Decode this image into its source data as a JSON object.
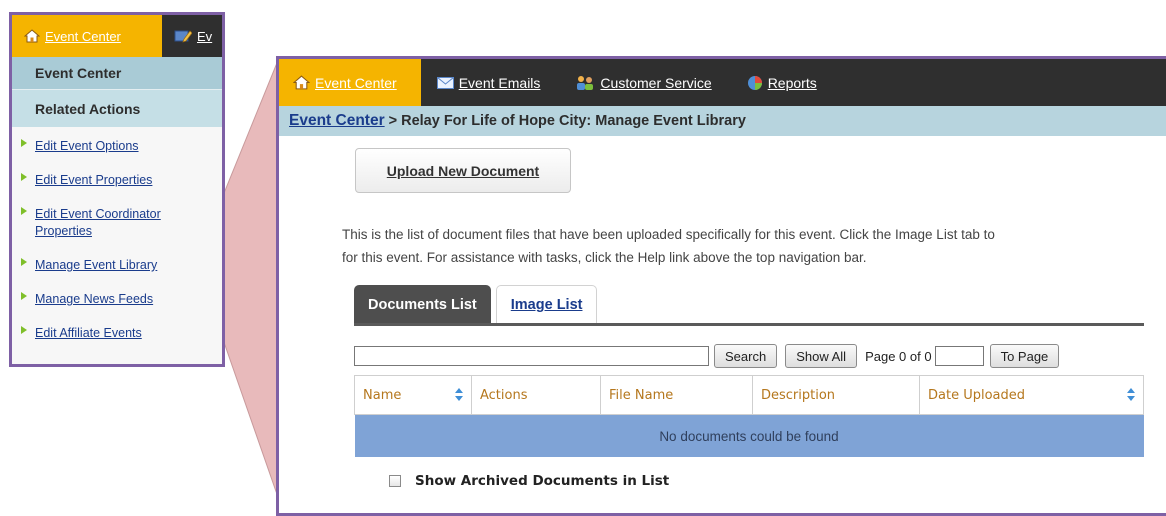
{
  "left_panel": {
    "nav_tabs": [
      {
        "label": "Event Center",
        "icon": "home-icon"
      },
      {
        "label": "Ev",
        "icon": "email-edit-icon"
      }
    ],
    "header": "Event Center",
    "subheader": "Related Actions",
    "actions": [
      {
        "label": "Edit Event Options"
      },
      {
        "label": "Edit Event Properties"
      },
      {
        "label": "Edit Event Coordinator Properties"
      },
      {
        "label": "Manage Event Library"
      },
      {
        "label": "Manage News Feeds"
      },
      {
        "label": "Edit Affiliate Events"
      }
    ]
  },
  "main_panel": {
    "nav": [
      {
        "label": "Event Center",
        "icon": "home-icon",
        "active": true
      },
      {
        "label": "Event Emails",
        "icon": "envelope-icon"
      },
      {
        "label": "Customer Service",
        "icon": "people-icon"
      },
      {
        "label": "Reports",
        "icon": "pie-chart-icon"
      }
    ],
    "breadcrumb": {
      "link": "Event Center",
      "separator": ">",
      "current": "Relay For Life of Hope City: Manage Event Library"
    },
    "upload_button": "Upload New Document",
    "description_line1": "This is the list of document files that have been uploaded specifically for this event. Click the Image List tab to",
    "description_line2": "for this event. For assistance with tasks, click the Help link above the top navigation bar.",
    "tabs": [
      {
        "label": "Documents List",
        "active": true
      },
      {
        "label": "Image List",
        "active": false
      }
    ],
    "toolbar": {
      "search_value": "",
      "search_button": "Search",
      "show_all_button": "Show All",
      "page_text": "Page 0 of 0",
      "page_input_value": "",
      "to_page_button": "To Page"
    },
    "table": {
      "columns": [
        "Name",
        "Actions",
        "File Name",
        "Description",
        "Date Uploaded"
      ],
      "empty_message": "No documents could be found"
    },
    "archived_checkbox": {
      "label": "Show Archived Documents in List",
      "checked": false
    }
  },
  "colors": {
    "frame": "#7e60a5",
    "nav_bg": "#2f2f2f",
    "nav_active": "#f5b400",
    "breadcrumb_bg": "#b7d4de",
    "link": "#1a3c8c",
    "header_text": "#b5771d",
    "empty_row": "#7fa3d6",
    "connector": "#e8b7b7"
  }
}
